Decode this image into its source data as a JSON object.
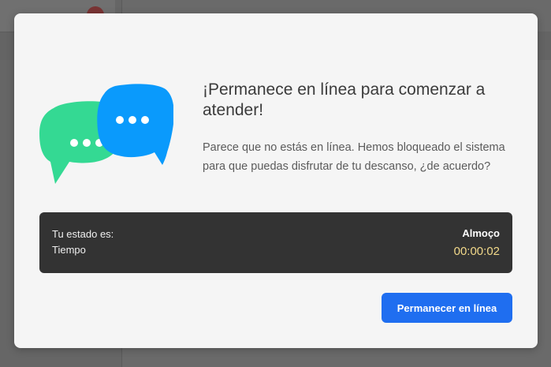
{
  "modal": {
    "title": "¡Permanece en línea para comenzar a atender!",
    "message": "Parece que no estás en línea. Hemos bloqueado el sistema para que puedas disfrutar de tu descanso, ¿de acuerdo?",
    "status": {
      "status_label": "Tu estado es:",
      "time_label": "Tiempo",
      "status_value": "Almoço",
      "time_value": "00:00:02"
    },
    "button_label": "Permanecer en línea"
  },
  "illustration": {
    "icon": "chat-bubbles-icon",
    "colors": {
      "back_bubble": "#34d993",
      "front_bubble": "#0a9afc",
      "dots": "#ffffff"
    }
  },
  "colors": {
    "overlay": "#5f5f5f",
    "modal_bg": "#f5f5f5",
    "panel_bg": "#333333",
    "timer_text": "#f2d98a",
    "accent": "#1f6ef0"
  }
}
